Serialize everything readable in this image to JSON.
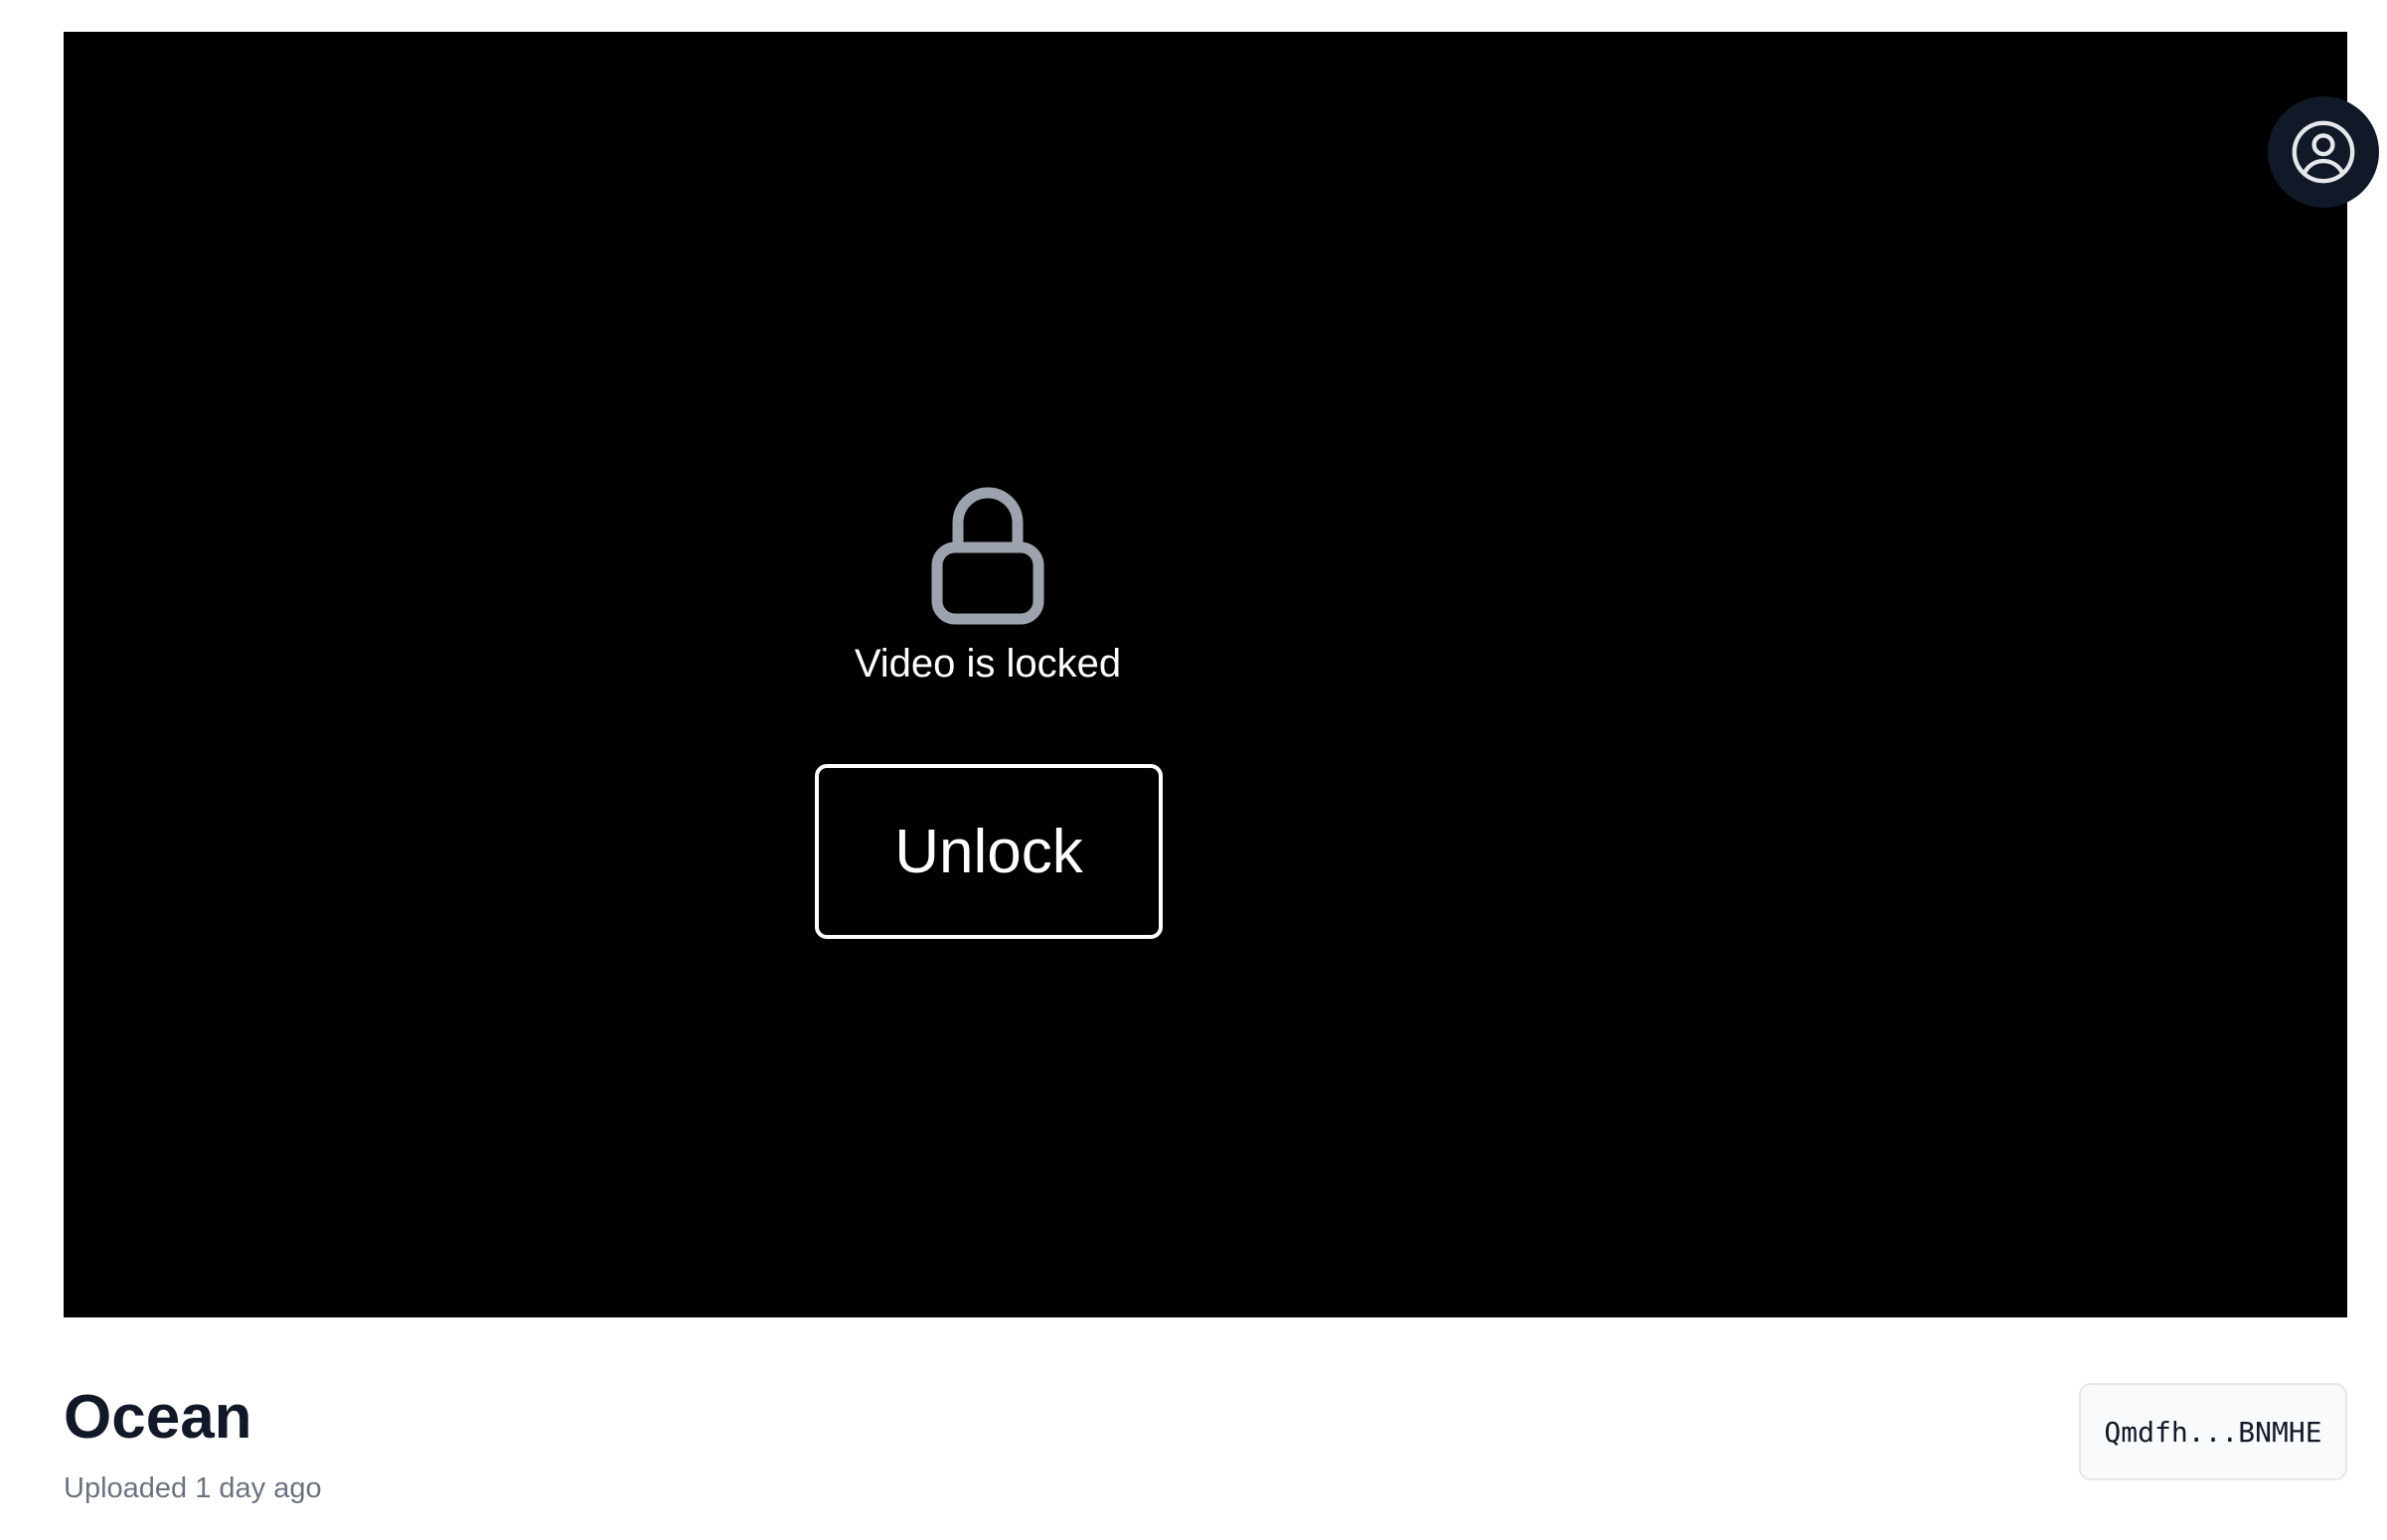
{
  "player": {
    "account_icon": "user-circle-icon",
    "lock_icon": "lock-icon",
    "locked_message": "Video is locked",
    "unlock_label": "Unlock"
  },
  "video": {
    "title": "Ocean",
    "uploaded": "Uploaded 1 day ago",
    "hash": "Qmdfh...BNMHE"
  },
  "colors": {
    "player_background": "#000000",
    "account_button_background": "#111827",
    "lock_icon_color": "#9ca3af",
    "title_color": "#111827",
    "muted_text": "#6b7280",
    "badge_background": "#f9fafb",
    "badge_border": "#e5e7eb"
  }
}
